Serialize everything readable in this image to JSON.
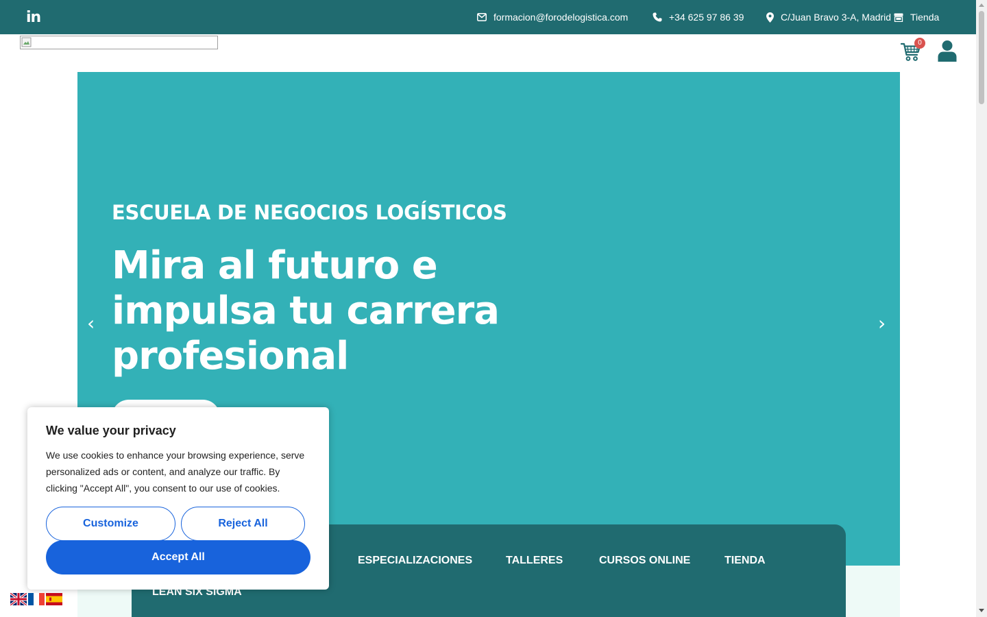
{
  "topbar": {
    "email": "formacion@forodelogistica.com",
    "phone": "+34 625 97 86 39",
    "address": "C/Juan Bravo 3-A, Madrid",
    "shop": "Tienda",
    "bg_color": "#206b70"
  },
  "header": {
    "cart_count": "0"
  },
  "hero": {
    "kicker": "ESCUELA DE NEGOCIOS LOGÍSTICOS",
    "title": "Mira al futuro e impulsa tu carrera profesional",
    "bg_color": "#33b1b7",
    "prev_arrow": "‹",
    "next_arrow": "›"
  },
  "nav": {
    "items": [
      "ESPECIALIZACIONES",
      "TALLERES",
      "CURSOS ONLINE",
      "TIENDA",
      "LEAN SIX SIGMA"
    ]
  },
  "cookie": {
    "title": "We value your privacy",
    "body": "We use cookies to enhance your browsing experience, serve personalized ads or content, and analyze our traffic. By clicking \"Accept All\", you consent to our use of cookies.",
    "customize": "Customize",
    "reject": "Reject All",
    "accept": "Accept All",
    "accent_color": "#1863dc"
  },
  "icons": [
    "linkedin-icon",
    "envelope-icon",
    "phone-icon",
    "map-pin-icon",
    "store-icon",
    "cart-icon",
    "user-icon",
    "chevron-left-icon",
    "chevron-right-icon"
  ]
}
